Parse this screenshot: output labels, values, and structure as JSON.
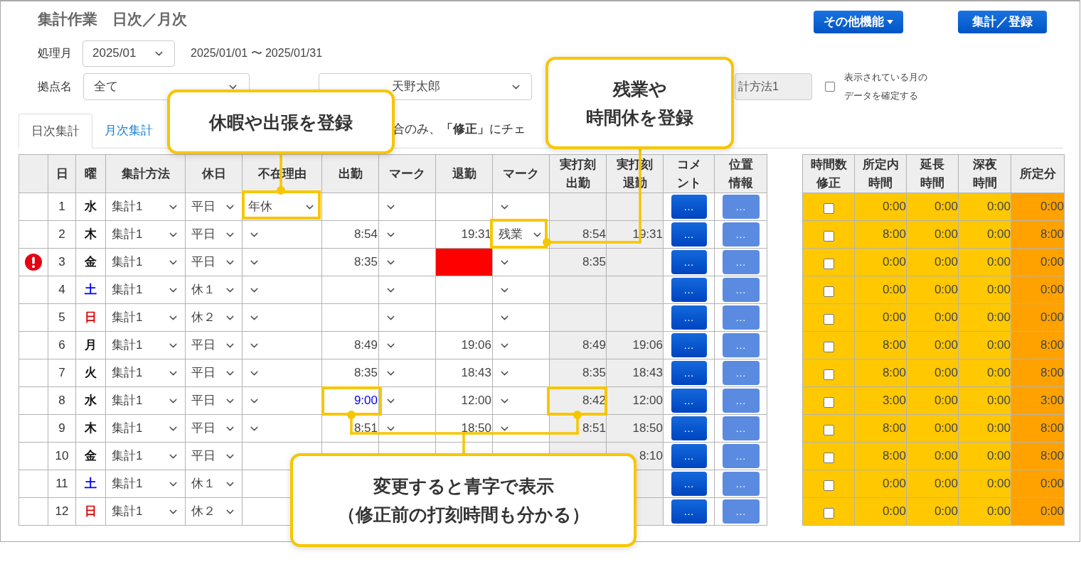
{
  "page_title": "集計作業　日次／月次",
  "header_buttons": [
    {
      "label": "その他機能",
      "kind": "menu"
    },
    {
      "label": "集計／登録",
      "kind": "plain"
    }
  ],
  "filters": {
    "month_label": "処理月",
    "month_value": "2025/01",
    "range": "2025/01/01 〜 2025/01/31",
    "site_label": "拠点名",
    "site_value": "全て",
    "employee_value": "天野太郎",
    "method_value": "計方法1",
    "confirm_checked": false,
    "confirm_label": [
      "表示されている月の",
      "データを確定する"
    ]
  },
  "tabs": [
    {
      "label": "日次集計",
      "selected": true
    },
    {
      "label": "月次集計",
      "selected": false
    }
  ],
  "tab_note": "合のみ、**「修正」**にチェ",
  "daily_table": {
    "columns": [
      [
        "日"
      ],
      [
        "曜"
      ],
      [
        "集計方法"
      ],
      [
        "休日"
      ],
      [
        "不在理由"
      ],
      [
        "出勤"
      ],
      [
        "マーク"
      ],
      [
        "退勤"
      ],
      [
        "マーク"
      ],
      [
        "実打刻",
        "出勤"
      ],
      [
        "実打刻",
        "退勤"
      ],
      [
        "コメ",
        "ント"
      ],
      [
        "位置",
        "情報"
      ]
    ],
    "rows": [
      {
        "day": "1",
        "weekday": "水",
        "color": "#111111",
        "error": false,
        "method": "集計1",
        "holiday": "平日",
        "absence": "年休",
        "comment": "…",
        "location": "…"
      },
      {
        "day": "2",
        "weekday": "木",
        "color": "#111111",
        "error": false,
        "method": "集計1",
        "holiday": "平日",
        "clock_in": {
          "time": "8:54",
          "modified": false
        },
        "clock_out": {
          "time": "19:31",
          "missing": false
        },
        "clock_out_mark": "残業",
        "actual_in": "8:54",
        "actual_out": "19:31",
        "comment": "…",
        "location": "…"
      },
      {
        "day": "3",
        "weekday": "金",
        "color": "#111111",
        "error": true,
        "method": "集計1",
        "holiday": "平日",
        "clock_in": {
          "time": "8:35",
          "modified": false
        },
        "clock_out": {
          "missing": true
        },
        "actual_in": "8:35",
        "comment": "…",
        "location": "…"
      },
      {
        "day": "4",
        "weekday": "土",
        "color": "#0000ff",
        "error": false,
        "method": "集計1",
        "holiday": "休１",
        "comment": "…",
        "location": "…"
      },
      {
        "day": "5",
        "weekday": "日",
        "color": "#e00000",
        "error": false,
        "method": "集計1",
        "holiday": "休２",
        "comment": "…",
        "location": "…"
      },
      {
        "day": "6",
        "weekday": "月",
        "color": "#111111",
        "error": false,
        "method": "集計1",
        "holiday": "平日",
        "clock_in": {
          "time": "8:49",
          "modified": false
        },
        "clock_out": {
          "time": "19:06",
          "missing": false
        },
        "actual_in": "8:49",
        "actual_out": "19:06",
        "comment": "…",
        "location": "…"
      },
      {
        "day": "7",
        "weekday": "火",
        "color": "#111111",
        "error": false,
        "method": "集計1",
        "holiday": "平日",
        "clock_in": {
          "time": "8:35",
          "modified": false
        },
        "clock_out": {
          "time": "18:43",
          "missing": false
        },
        "actual_in": "8:35",
        "actual_out": "18:43",
        "comment": "…",
        "location": "…"
      },
      {
        "day": "8",
        "weekday": "水",
        "color": "#111111",
        "error": false,
        "method": "集計1",
        "holiday": "平日",
        "clock_in": {
          "time": "9:00",
          "modified": true
        },
        "clock_out": {
          "time": "12:00",
          "missing": false
        },
        "actual_in": "8:42",
        "actual_out": "12:00",
        "comment": "…",
        "location": "…"
      },
      {
        "day": "9",
        "weekday": "木",
        "color": "#111111",
        "error": false,
        "method": "集計1",
        "holiday": "平日",
        "clock_in": {
          "time": "8:51",
          "modified": false
        },
        "clock_out": {
          "time": "18:50",
          "missing": false
        },
        "actual_in": "8:51",
        "actual_out": "18:50",
        "comment": "…",
        "location": "…"
      },
      {
        "day": "10",
        "weekday": "金",
        "color": "#111111",
        "error": false,
        "method": "集計1",
        "holiday": "平日",
        "actual_out": "8:10",
        "comment": "…",
        "location": "…"
      },
      {
        "day": "11",
        "weekday": "土",
        "color": "#0000ff",
        "error": false,
        "method": "集計1",
        "holiday": "休１",
        "comment": "…",
        "location": "…"
      },
      {
        "day": "12",
        "weekday": "日",
        "color": "#e00000",
        "error": false,
        "method": "集計1",
        "holiday": "休２",
        "comment": "…",
        "location": "…"
      }
    ]
  },
  "totals_table": {
    "columns": [
      [
        "時間数",
        "修正"
      ],
      [
        "所定内",
        "時間"
      ],
      [
        "延長",
        "時間"
      ],
      [
        "深夜",
        "時間"
      ],
      [
        "所定分"
      ]
    ],
    "rows": [
      {
        "checked": false,
        "values": [
          "0:00",
          "0:00",
          "0:00",
          "0:00"
        ]
      },
      {
        "checked": false,
        "values": [
          "8:00",
          "0:00",
          "0:00",
          "8:00"
        ]
      },
      {
        "checked": false,
        "values": [
          "0:00",
          "0:00",
          "0:00",
          "0:00"
        ]
      },
      {
        "checked": false,
        "values": [
          "0:00",
          "0:00",
          "0:00",
          "0:00"
        ]
      },
      {
        "checked": false,
        "values": [
          "0:00",
          "0:00",
          "0:00",
          "0:00"
        ]
      },
      {
        "checked": false,
        "values": [
          "8:00",
          "0:00",
          "0:00",
          "8:00"
        ]
      },
      {
        "checked": false,
        "values": [
          "8:00",
          "0:00",
          "0:00",
          "8:00"
        ]
      },
      {
        "checked": false,
        "values": [
          "3:00",
          "0:00",
          "0:00",
          "3:00"
        ]
      },
      {
        "checked": false,
        "values": [
          "8:00",
          "0:00",
          "0:00",
          "8:00"
        ]
      },
      {
        "checked": false,
        "values": [
          "8:00",
          "0:00",
          "0:00",
          "8:00"
        ]
      },
      {
        "checked": false,
        "values": [
          "0:00",
          "0:00",
          "0:00",
          "0:00"
        ]
      },
      {
        "checked": false,
        "values": [
          "0:00",
          "0:00",
          "0:00",
          "0:00"
        ]
      }
    ]
  },
  "callouts": [
    {
      "lines": [
        "休暇や出張を登録"
      ]
    },
    {
      "lines": [
        "残業や",
        "時間休を登録"
      ]
    },
    {
      "lines": [
        "変更すると青字で表示",
        "（修正前の打刻時間も分かる）"
      ]
    }
  ]
}
